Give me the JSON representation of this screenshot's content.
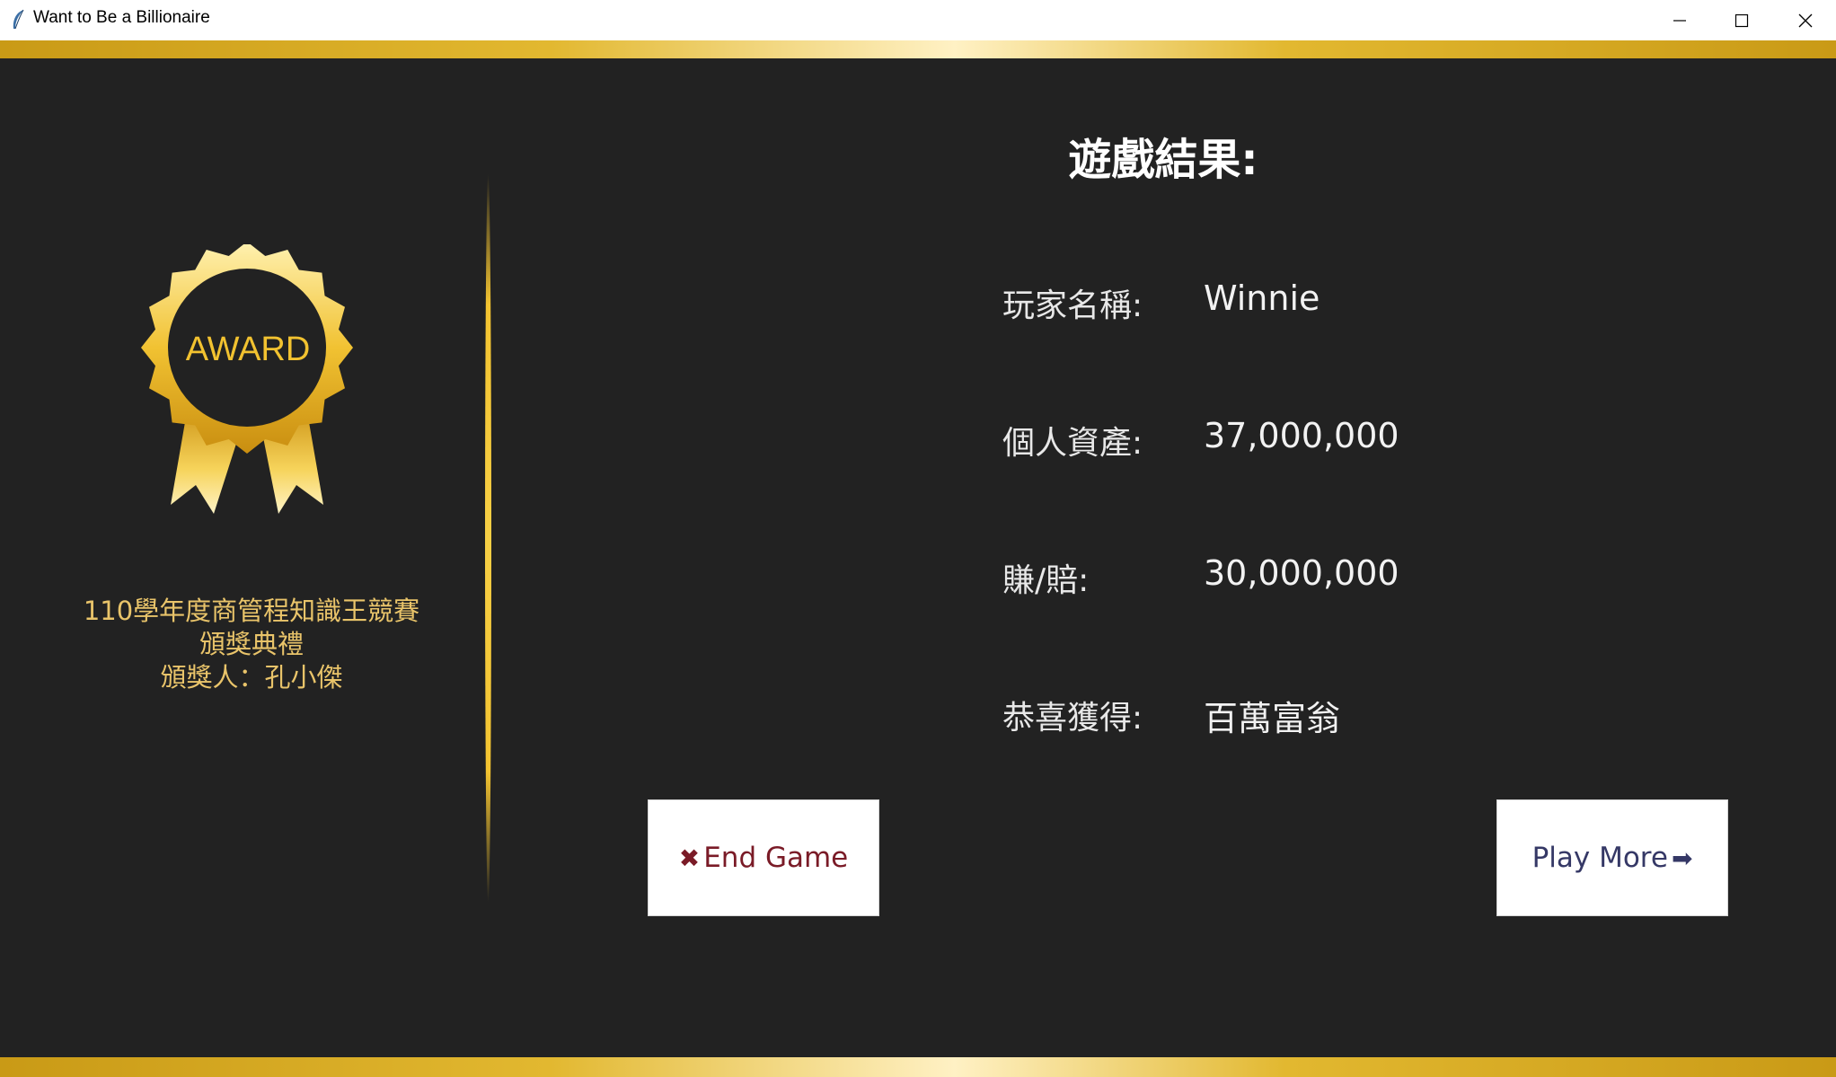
{
  "window": {
    "title": "Want to Be a Billionaire",
    "minimize_icon": "minimize-icon",
    "maximize_icon": "maximize-icon",
    "close_icon": "close-icon"
  },
  "award": {
    "badge_text": "AWARD",
    "gold": "#f2c230"
  },
  "caption": {
    "line1": "110學年度商管程知識王競賽",
    "line2": "頒獎典禮",
    "line3": "頒獎人：孔小傑"
  },
  "result": {
    "title": "遊戲結果:",
    "rows": [
      {
        "label": "玩家名稱:",
        "value": "Winnie"
      },
      {
        "label": "個人資產:",
        "value": "37,000,000"
      },
      {
        "label": "賺/賠:",
        "value": "30,000,000"
      },
      {
        "label": "恭喜獲得:",
        "value": "百萬富翁"
      }
    ]
  },
  "buttons": {
    "end": {
      "icon": "✖",
      "label": "End Game"
    },
    "more": {
      "label": "Play More",
      "icon": "➡"
    }
  },
  "colors": {
    "background": "#222222",
    "gold": "#e2b830",
    "caption": "#e9c46a",
    "end_text": "#7a1b27",
    "more_text": "#353866"
  }
}
